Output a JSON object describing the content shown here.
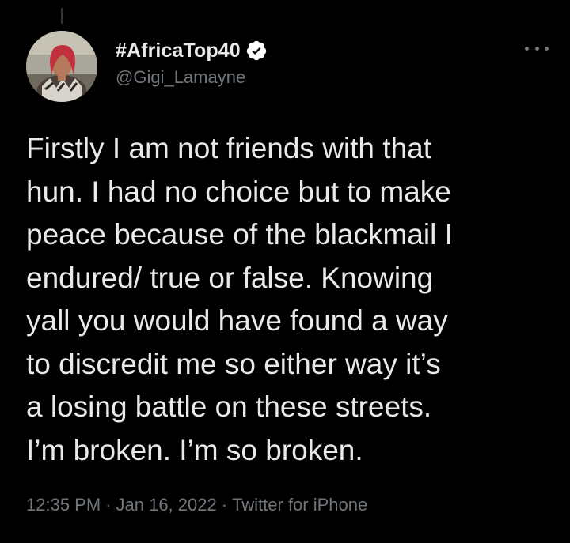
{
  "tweet": {
    "author": {
      "display_name": "#AfricaTop40",
      "handle": "@Gigi_Lamayne",
      "verified": true,
      "avatar_icon": "profile-photo"
    },
    "more_icon": "more-options-icon",
    "text_lines": [
      "Firstly I am not friends with that",
      "hun. I had no choice but to make",
      "peace because of the blackmail I",
      "endured/ true or false. Knowing",
      "yall you would have found a way",
      "to discredit me so either way it’s",
      "a losing battle on these streets.",
      "I’m broken. I’m so broken."
    ],
    "meta": {
      "time": "12:35 PM",
      "separator": "·",
      "date": "Jan 16, 2022",
      "source": "Twitter for iPhone"
    }
  },
  "colors": {
    "background": "#000000",
    "text_primary": "#e7e9ea",
    "text_secondary": "#71767b",
    "verified_badge": "#ffffff"
  }
}
